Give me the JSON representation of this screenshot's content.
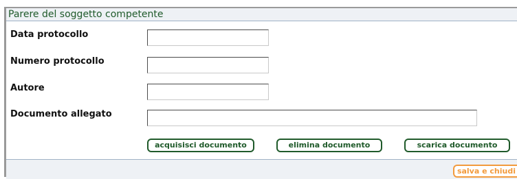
{
  "section": {
    "title": "Parere del soggetto competente"
  },
  "fields": {
    "data_protocollo": {
      "label": "Data protocollo",
      "value": ""
    },
    "numero_protocollo": {
      "label": "Numero protocollo",
      "value": ""
    },
    "autore": {
      "label": "Autore",
      "value": ""
    },
    "documento_allegato": {
      "label": "Documento allegato",
      "value": ""
    }
  },
  "buttons": {
    "acquisisci": "acquisisci documento",
    "elimina": "elimina documento",
    "scarica": "scarica documento",
    "salva_chiudi": "salva e chiudi"
  }
}
